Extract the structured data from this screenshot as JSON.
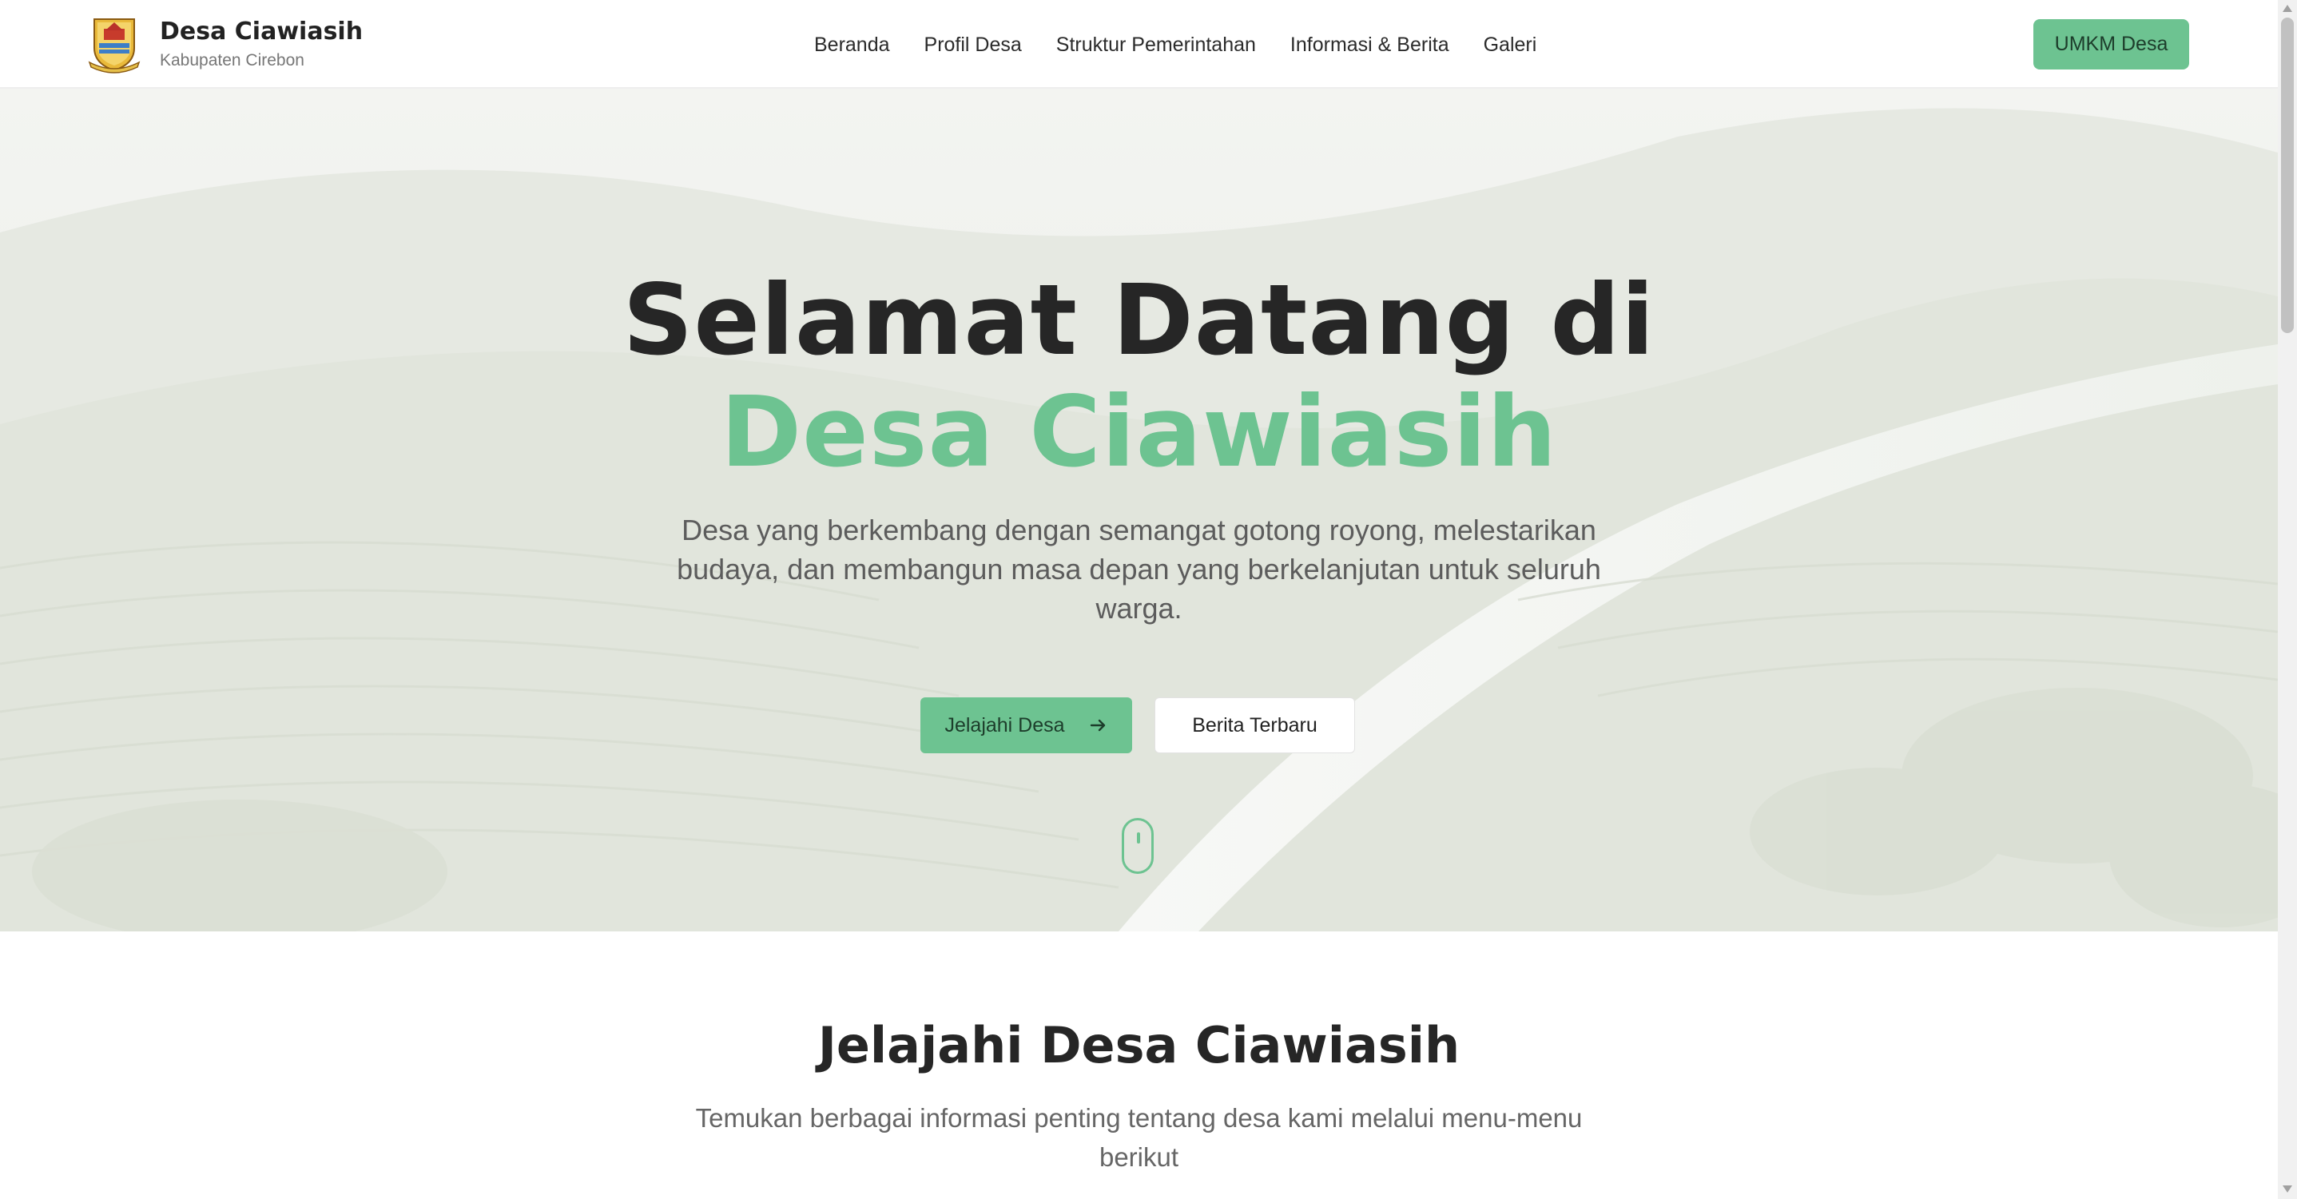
{
  "brand": {
    "name": "Desa Ciawiasih",
    "subtitle": "Kabupaten Cirebon",
    "logo_icon": "village-emblem-icon"
  },
  "nav": {
    "items": [
      {
        "label": "Beranda"
      },
      {
        "label": "Profil Desa"
      },
      {
        "label": "Struktur Pemerintahan"
      },
      {
        "label": "Informasi & Berita"
      },
      {
        "label": "Galeri"
      }
    ],
    "cta_label": "UMKM Desa"
  },
  "hero": {
    "title_line1": "Selamat Datang di",
    "title_line2": "Desa Ciawiasih",
    "description": "Desa yang berkembang dengan semangat gotong royong, melestarikan budaya, dan membangun masa depan yang berkelanjutan untuk seluruh warga.",
    "primary_button": "Jelajahi Desa",
    "primary_button_icon": "arrow-right-icon",
    "secondary_button": "Berita Terbaru",
    "scroll_indicator_icon": "mouse-scroll-icon"
  },
  "explore": {
    "title": "Jelajahi Desa Ciawiasih",
    "description": "Temukan berbagai informasi penting tentang desa kami melalui menu-menu berikut"
  },
  "colors": {
    "accent": "#6dc391",
    "heading": "#262626",
    "body_text": "#5c5c5c",
    "background": "#ffffff"
  }
}
